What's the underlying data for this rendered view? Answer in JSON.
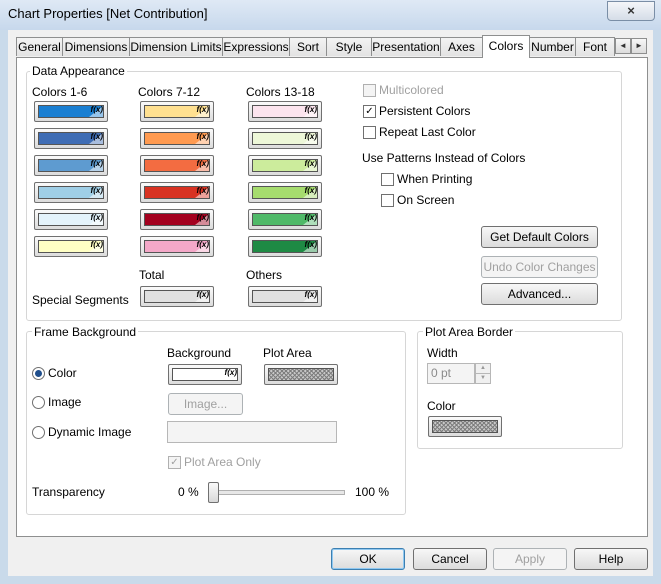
{
  "window": {
    "title": "Chart Properties [Net Contribution]",
    "close_glyph": "×"
  },
  "tabs": [
    {
      "label": "General"
    },
    {
      "label": "Dimensions"
    },
    {
      "label": "Dimension Limits"
    },
    {
      "label": "Expressions"
    },
    {
      "label": "Sort"
    },
    {
      "label": "Style"
    },
    {
      "label": "Presentation"
    },
    {
      "label": "Axes"
    },
    {
      "label": "Colors",
      "active": true
    },
    {
      "label": "Number"
    },
    {
      "label": "Font"
    }
  ],
  "tab_scroll": {
    "left": "◄",
    "right": "►"
  },
  "data_appearance": {
    "title": "Data Appearance",
    "col1_label": "Colors 1-6",
    "col2_label": "Colors 7-12",
    "col3_label": "Colors 13-18",
    "fx": "f(x)",
    "colors_1_6": [
      "#1a7fd2",
      "#3f6db5",
      "#5e9bd0",
      "#9fcfe7",
      "#e4f3fb",
      "#ffffc4"
    ],
    "colors_7_12": [
      "#ffe090",
      "#ff9a50",
      "#f36c41",
      "#d83222",
      "#a3001e",
      "#f4a8c8"
    ],
    "colors_13_18": [
      "#fce4ee",
      "#edf7d8",
      "#ccec9c",
      "#a6dc6e",
      "#4fb968",
      "#1e8a44"
    ],
    "total_label": "Total",
    "others_label": "Others",
    "special_segments_label": "Special Segments",
    "total_color": "#e0e0e0",
    "others_color": "#e0e0e0",
    "multicolored": {
      "label": "Multicolored",
      "checked": false
    },
    "persistent": {
      "label": "Persistent Colors",
      "checked": true
    },
    "repeat_last": {
      "label": "Repeat Last Color",
      "checked": false
    },
    "patterns_label": "Use Patterns Instead of Colors",
    "when_printing": {
      "label": "When Printing",
      "checked": false
    },
    "on_screen": {
      "label": "On Screen",
      "checked": false
    },
    "get_default_btn": "Get Default Colors",
    "undo_btn": "Undo Color Changes",
    "advanced_btn": "Advanced..."
  },
  "frame_background": {
    "title": "Frame Background",
    "background_label": "Background",
    "plot_area_label": "Plot Area",
    "background_color": "#ffffff",
    "options": [
      {
        "label": "Color",
        "checked": true
      },
      {
        "label": "Image",
        "checked": false
      },
      {
        "label": "Dynamic Image",
        "checked": false
      }
    ],
    "image_btn": "Image...",
    "plot_area_only": {
      "label": "Plot Area Only",
      "checked": true
    },
    "transparency_label": "Transparency",
    "transparency_min": "0 %",
    "transparency_max": "100 %",
    "transparency_value": 0
  },
  "plot_area_border": {
    "title": "Plot Area Border",
    "width_label": "Width",
    "width_value": "0 pt",
    "color_label": "Color"
  },
  "check_glyph": "✓",
  "spin_up": "▲",
  "spin_down": "▼",
  "footer": {
    "ok": "OK",
    "cancel": "Cancel",
    "apply": "Apply",
    "help": "Help"
  }
}
